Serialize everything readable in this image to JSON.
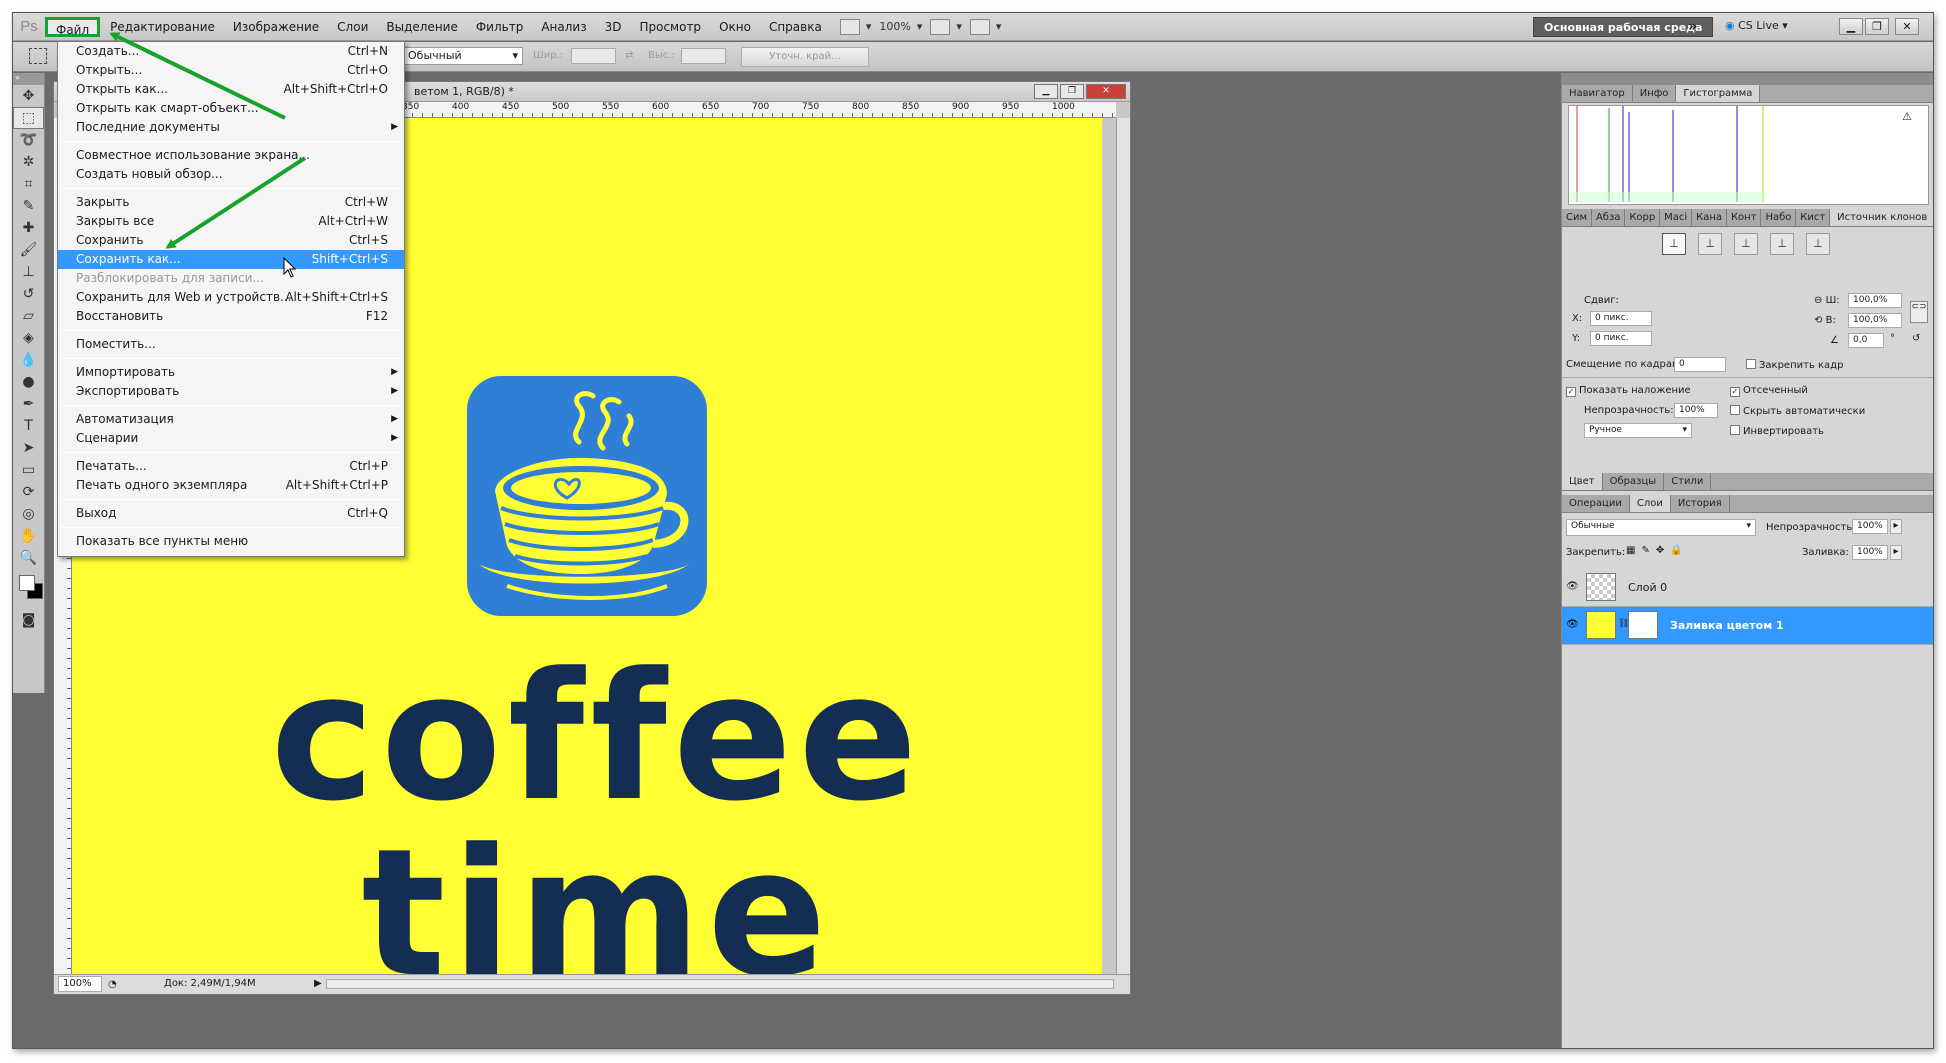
{
  "app": {
    "logo": "Ps"
  },
  "menubar": {
    "items": [
      "Файл",
      "Редактирование",
      "Изображение",
      "Слои",
      "Выделение",
      "Фильтр",
      "Анализ",
      "3D",
      "Просмотр",
      "Окно",
      "Справка"
    ],
    "zoom": "100%",
    "workspace": "Основная рабочая среда",
    "cslive": "CS Live"
  },
  "options": {
    "style_value": "Обычный",
    "width_label": "Шир.:",
    "height_label": "Выс.:",
    "refine_edge": "Уточн. край..."
  },
  "document": {
    "title": "ветом 1, RGB/8) *",
    "ruler_labels": [
      "350",
      "400",
      "450",
      "500",
      "550",
      "600",
      "650",
      "700",
      "750",
      "800",
      "850",
      "900",
      "950",
      "1000"
    ],
    "canvas_color": "#ffff33",
    "logo_text": "coffee time",
    "logo_text_color": "#142d52",
    "logo_box_color": "#2f7fd6",
    "zoom": "100%",
    "doc_size": "Док: 2,49M/1,94M"
  },
  "file_menu": {
    "items": [
      {
        "label": "Создать...",
        "shortcut": "Ctrl+N"
      },
      {
        "label": "Открыть...",
        "shortcut": "Ctrl+O"
      },
      {
        "label": "Открыть как...",
        "shortcut": "Alt+Shift+Ctrl+O"
      },
      {
        "label": "Открыть как смарт-объект...",
        "shortcut": ""
      },
      {
        "label": "Последние документы",
        "shortcut": "",
        "submenu": true
      },
      {
        "sep": true
      },
      {
        "label": "Совместное использование экрана...",
        "shortcut": ""
      },
      {
        "label": "Создать новый обзор...",
        "shortcut": ""
      },
      {
        "sep": true
      },
      {
        "label": "Закрыть",
        "shortcut": "Ctrl+W"
      },
      {
        "label": "Закрыть все",
        "shortcut": "Alt+Ctrl+W"
      },
      {
        "label": "Сохранить",
        "shortcut": "Ctrl+S"
      },
      {
        "label": "Сохранить как...",
        "shortcut": "Shift+Ctrl+S",
        "highlighted": true
      },
      {
        "label": "Разблокировать для записи...",
        "shortcut": "",
        "disabled": true
      },
      {
        "label": "Сохранить для Web и устройств...",
        "shortcut": "Alt+Shift+Ctrl+S"
      },
      {
        "label": "Восстановить",
        "shortcut": "F12"
      },
      {
        "sep": true
      },
      {
        "label": "Поместить...",
        "shortcut": ""
      },
      {
        "sep": true
      },
      {
        "label": "Импортировать",
        "shortcut": "",
        "submenu": true
      },
      {
        "label": "Экспортировать",
        "shortcut": "",
        "submenu": true
      },
      {
        "sep": true
      },
      {
        "label": "Автоматизация",
        "shortcut": "",
        "submenu": true
      },
      {
        "label": "Сценарии",
        "shortcut": "",
        "submenu": true
      },
      {
        "sep": true
      },
      {
        "label": "Печатать...",
        "shortcut": "Ctrl+P"
      },
      {
        "label": "Печать одного экземпляра",
        "shortcut": "Alt+Shift+Ctrl+P"
      },
      {
        "sep": true
      },
      {
        "label": "Выход",
        "shortcut": "Ctrl+Q"
      },
      {
        "sep": true
      },
      {
        "label": "Показать все пункты меню",
        "shortcut": ""
      }
    ]
  },
  "panels": {
    "top_tabs": [
      "Навигатор",
      "Инфо",
      "Гистограмма"
    ],
    "clone_tabs": [
      "Сим",
      "Абза",
      "Корр",
      "Масі",
      "Кана",
      "Конт",
      "Набо",
      "Кист",
      "Источник клонов"
    ],
    "clone": {
      "offset_label": "Сдвиг:",
      "x_label": "X:",
      "x_value": "0 пикс.",
      "y_label": "Y:",
      "y_value": "0 пикс.",
      "w_label": "Ш:",
      "w_value": "100,0%",
      "h_label": "В:",
      "h_value": "100,0%",
      "angle_value": "0,0",
      "angle_unit": "°",
      "frame_offset_label": "Смещение по кадрам:",
      "frame_offset_value": "0",
      "lock_frame": "Закрепить кадр",
      "show_overlay": "Показать наложение",
      "clipped": "Отсеченный",
      "opacity_label": "Непрозрачность:",
      "opacity_value": "100%",
      "auto_hide": "Скрыть автоматически",
      "mode_value": "Ручное",
      "invert": "Инвертировать"
    },
    "color_tabs": [
      "Цвет",
      "Образцы",
      "Стили"
    ],
    "layer_tabs": [
      "Операции",
      "Слои",
      "История"
    ],
    "layers": {
      "blend_mode": "Обычные",
      "opacity_label": "Непрозрачность:",
      "opacity_value": "100%",
      "lock_label": "Закрепить:",
      "fill_label": "Заливка:",
      "fill_value": "100%",
      "items": [
        {
          "name": "Слой 0",
          "selected": false
        },
        {
          "name": "Заливка цветом 1",
          "selected": true
        }
      ]
    }
  },
  "colors": {
    "highlight": "#3399ff",
    "annotation": "#18a22c"
  }
}
